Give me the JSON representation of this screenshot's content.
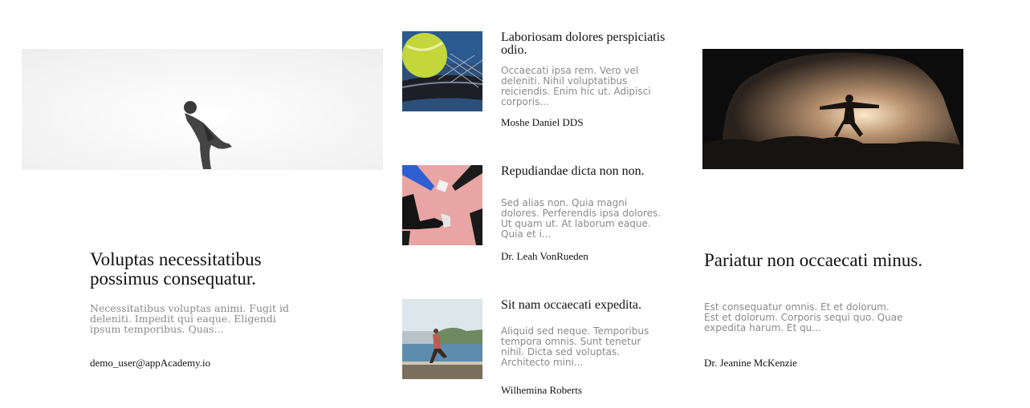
{
  "featured_left": {
    "title": "Voluptas necessitatibus possimus consequatur.",
    "excerpt": "Necessitatibus voluptas animi. Fugit id deleniti. Impedit qui eaque. Eligendi ipsum temporibus. Quas...",
    "author": "demo_user@appAcademy.io"
  },
  "middle_list": [
    {
      "title": "Laboriosam dolores perspiciatis odio.",
      "excerpt": "Occaecati ipsa rem. Vero vel deleniti. Nihil voluptatibus reiciendis. Enim hic ut. Adipisci corporis...",
      "author": "Moshe Daniel DDS"
    },
    {
      "title": "Repudiandae dicta non non.",
      "excerpt": "Sed alias non. Quia magni dolores. Perferendis ipsa dolores. Ut quam ut. At laborum eaque. Quia et i...",
      "author": "Dr. Leah VonRueden"
    },
    {
      "title": "Sit nam occaecati expedita.",
      "excerpt": "Aliquid sed neque. Temporibus tempora omnis. Sunt tenetur nihil. Dicta sed voluptas. Architecto mini...",
      "author": "Wilhemina Roberts"
    }
  ],
  "featured_right": {
    "title": "Pariatur non occaecati minus.",
    "excerpt": "Est consequatur omnis. Et et dolorum. Est et dolorum. Corporis sequi quo. Quae expedita harum. Et qu...",
    "author": "Dr. Jeanine McKenzie"
  }
}
